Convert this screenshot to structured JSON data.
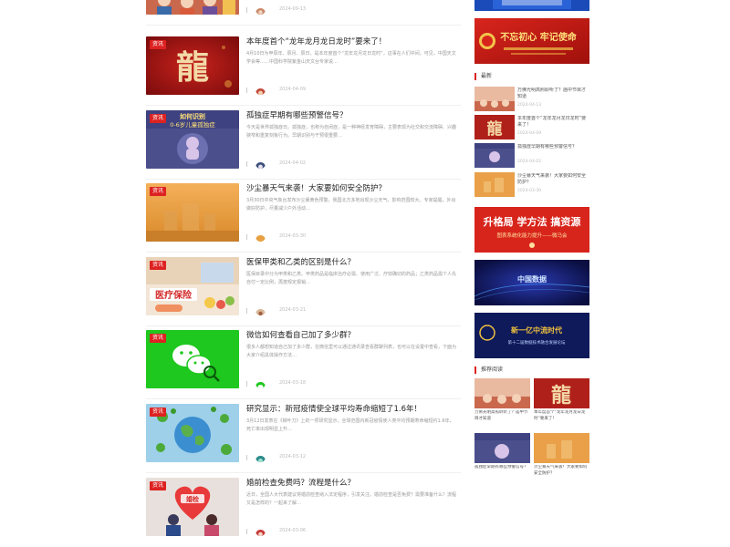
{
  "articles": [
    {
      "tag": "",
      "title": "",
      "excerpt": "",
      "date": "2024-09-13"
    },
    {
      "tag": "资讯",
      "title": "本年度首个“龙年龙月龙日龙时”要来了！",
      "excerpt": "4月10日为甲辰年、辰月、辰日，是本年度首个“龙年龙月龙日龙时”，这事在人们中间，可见，中国天文学会等……中国科学院紫金山天文台专家说…",
      "date": "2024-04-09"
    },
    {
      "tag": "资讯",
      "title": "孤独症早期有哪些预警信号？",
      "excerpt": "今天是世界孤独症日。孤独症，也称为自闭症，是一种神经发育障碍，主要表现为社交和交流障碍、兴趣狭窄和重复刻板行为。早期识别与干预很重要…",
      "date": "2024-04-02"
    },
    {
      "tag": "资讯",
      "title": "沙尘暴天气来袭！大家要如何安全防护？",
      "excerpt": "3月30日中央气象台发布沙尘暴黄色预警，我国北方多地出现沙尘天气，影响范围较大。专家提醒，外出做好防护，尽量减少户外活动…",
      "date": "2024-03-30"
    },
    {
      "tag": "资讯",
      "title": "医保甲类和乙类的区别是什么？",
      "excerpt": "医保目录中分为甲类和乙类。甲类药品是临床治疗必需、使用广泛、疗效确切的药品；乙类药品需个人先自付一定比例，再按规定报销…",
      "date": "2024-03-21"
    },
    {
      "tag": "资讯",
      "title": "微信如何查看自己加了多少群？",
      "excerpt": "很多人都想知道自己加了多少群，在微信里可以通过通讯录查看群聊列表，也可以在设置中查看，下面为大家介绍具体操作方法…",
      "date": "2024-03-18"
    },
    {
      "tag": "资讯",
      "title": "研究显示：新冠疫情使全球平均寿命缩短了1.6年！",
      "excerpt": "3月12日发表在《柳叶刀》上的一项研究显示，全球范围内新冠疫情使人类平均预期寿命缩短约1.6年，死亡率出现明显上升…",
      "date": "2024-03-12"
    },
    {
      "tag": "资讯",
      "title": "婚前检查免费吗？流程是什么？",
      "excerpt": "近日，全国人大代表建议将婚前检查纳入法定程序，引发关注。婚前检查是否免费？需要准备什么？流程又是怎样的？一起来了解…",
      "date": "2024-03-06"
    }
  ],
  "sidebar": {
    "banner_top_text": "",
    "banner_red_text": "不忘初心 牢记使命",
    "section_hot": "最新",
    "hot_items": [
      {
        "title": "万佛光明高照聆听了？庙中节目才知道",
        "date": "2024-04-13"
      },
      {
        "title": "本年度首个“龙年龙月龙日龙时”要来了！",
        "date": "2024-04-09"
      },
      {
        "title": "孤独症早期有哪些预警信号？",
        "date": "2024-04-02"
      },
      {
        "title": "沙尘暴天气来袭！大家要如何安全防护？",
        "date": "2024-03-30"
      }
    ],
    "banner_study_main": "升格局 学方法 搞资源",
    "banner_study_sub": "图表系统化能力提升——微马会",
    "banner_tech_text": "中国数据",
    "banner_era_main": "新一亿中流时代",
    "banner_era_sub": "第十二届数据技术融合发展论坛",
    "section_recommend": "推荐阅读",
    "grid_items": [
      {
        "title": "万佛光明高照聆听了？庙中节目才知道"
      },
      {
        "title": "本年度首个“龙年龙月龙日龙时”要来了！"
      },
      {
        "title": "孤独症早期有哪些预警信号？"
      },
      {
        "title": "沙尘暴天气来袭！大家要如何安全防护？"
      }
    ]
  },
  "thumb_texts": {
    "dragon_char": "龍",
    "autism_line1": "如何识别",
    "autism_line2": "0-6岁儿童孤独症",
    "insurance": "医疗保险",
    "wedding": "婚检"
  },
  "colors": {
    "accent_red": "#d22222",
    "wechat_green": "#1ec81e",
    "banner_blue": "#1a4bb8"
  }
}
